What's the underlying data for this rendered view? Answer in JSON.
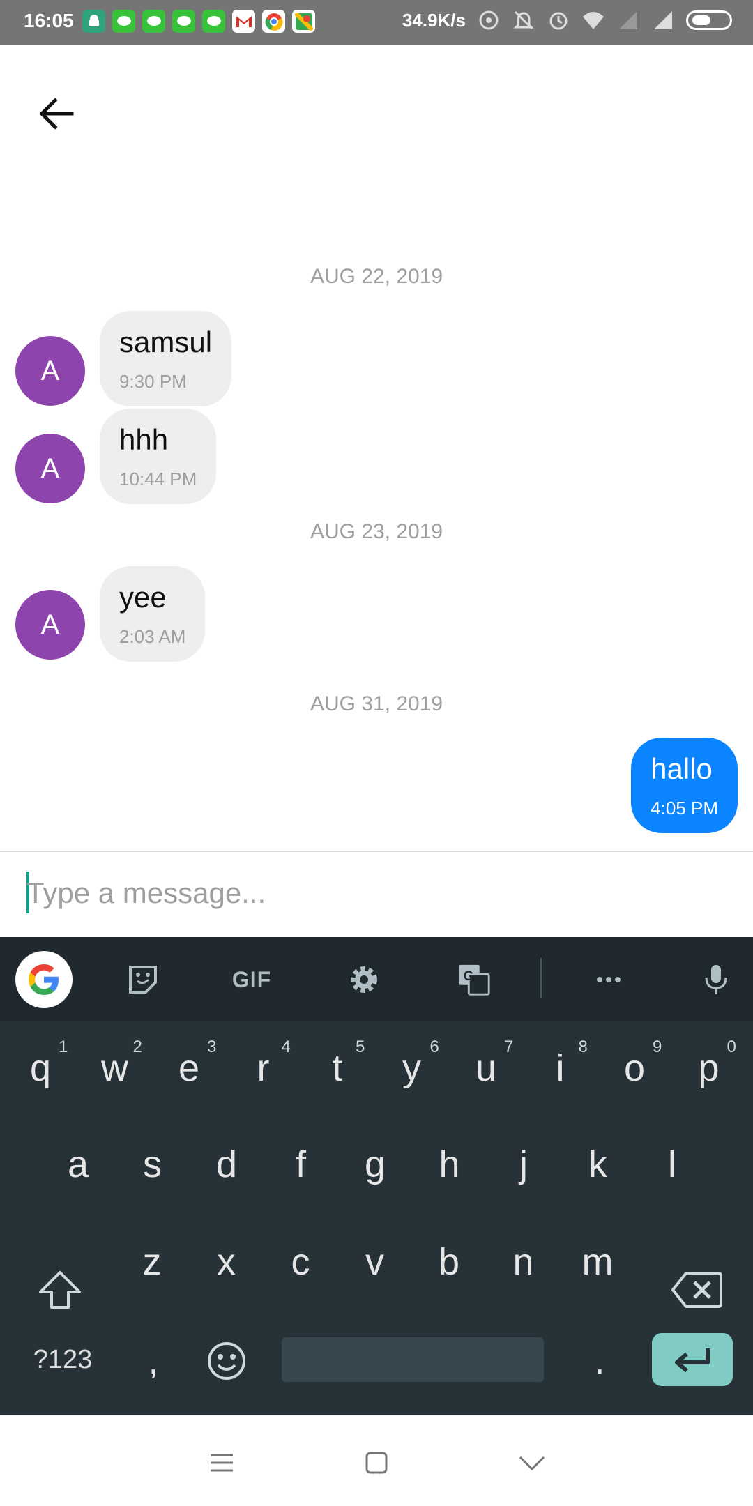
{
  "status_bar": {
    "time": "16:05",
    "net_speed": "34.9K/s",
    "notification_icons": [
      "android-icon",
      "line-icon",
      "line-icon",
      "line-icon",
      "line-icon",
      "gmail-icon",
      "chrome-icon",
      "maps-icon"
    ],
    "status_icons": [
      "hotspot-icon",
      "mute-icon",
      "alarm-icon",
      "wifi-icon",
      "signal-icon",
      "signal-icon",
      "battery-icon"
    ]
  },
  "header": {
    "back_icon": "back-arrow-icon"
  },
  "conversation": {
    "avatar_initial": "A",
    "groups": [
      {
        "date": "AUG 22, 2019"
      },
      {
        "date": "AUG 23, 2019"
      },
      {
        "date": "AUG 31, 2019"
      }
    ],
    "messages": [
      {
        "text": "samsul",
        "time": "9:30 PM",
        "direction": "incoming"
      },
      {
        "text": "hhh",
        "time": "10:44 PM",
        "direction": "incoming"
      },
      {
        "text": "yee",
        "time": "2:03 AM",
        "direction": "incoming"
      },
      {
        "text": "hallo",
        "time": "4:05 PM",
        "direction": "outgoing"
      }
    ]
  },
  "composer": {
    "placeholder": "Type a message..."
  },
  "keyboard": {
    "toolbar": {
      "gif_label": "GIF"
    },
    "row1": [
      {
        "key": "q",
        "hint": "1"
      },
      {
        "key": "w",
        "hint": "2"
      },
      {
        "key": "e",
        "hint": "3"
      },
      {
        "key": "r",
        "hint": "4"
      },
      {
        "key": "t",
        "hint": "5"
      },
      {
        "key": "y",
        "hint": "6"
      },
      {
        "key": "u",
        "hint": "7"
      },
      {
        "key": "i",
        "hint": "8"
      },
      {
        "key": "o",
        "hint": "9"
      },
      {
        "key": "p",
        "hint": "0"
      }
    ],
    "row2": [
      "a",
      "s",
      "d",
      "f",
      "g",
      "h",
      "j",
      "k",
      "l"
    ],
    "row3": [
      "z",
      "x",
      "c",
      "v",
      "b",
      "n",
      "m"
    ],
    "symbols_label": "?123",
    "comma": ",",
    "period": "."
  },
  "colors": {
    "avatar": "#8e44ad",
    "outgoing_bubble": "#0b84ff",
    "incoming_bubble": "#eeeeee",
    "keyboard_bg": "#263238",
    "enter_key": "#80cbc4"
  }
}
